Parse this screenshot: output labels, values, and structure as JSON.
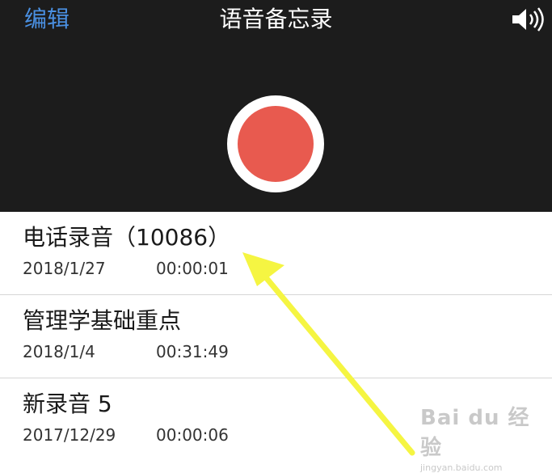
{
  "header": {
    "edit_label": "编辑",
    "title": "语音备忘录",
    "speaker_icon": "speaker-volume-icon"
  },
  "record_button": {
    "ring_color": "#ffffff",
    "fill_color": "#e85a4f"
  },
  "recordings": [
    {
      "name": "电话录音（10086）",
      "date": "2018/1/27",
      "duration": "00:00:01"
    },
    {
      "name": "管理学基础重点",
      "date": "2018/1/4",
      "duration": "00:31:49"
    },
    {
      "name": "新录音 5",
      "date": "2017/12/29",
      "duration": "00:00:06"
    }
  ],
  "annotation": {
    "arrow_color": "#f5f542"
  },
  "watermark": {
    "logo": "Bai du 经验",
    "url": "jingyan.baidu.com"
  },
  "colors": {
    "accent": "#4a90e2",
    "header_bg": "#1c1c1c"
  }
}
